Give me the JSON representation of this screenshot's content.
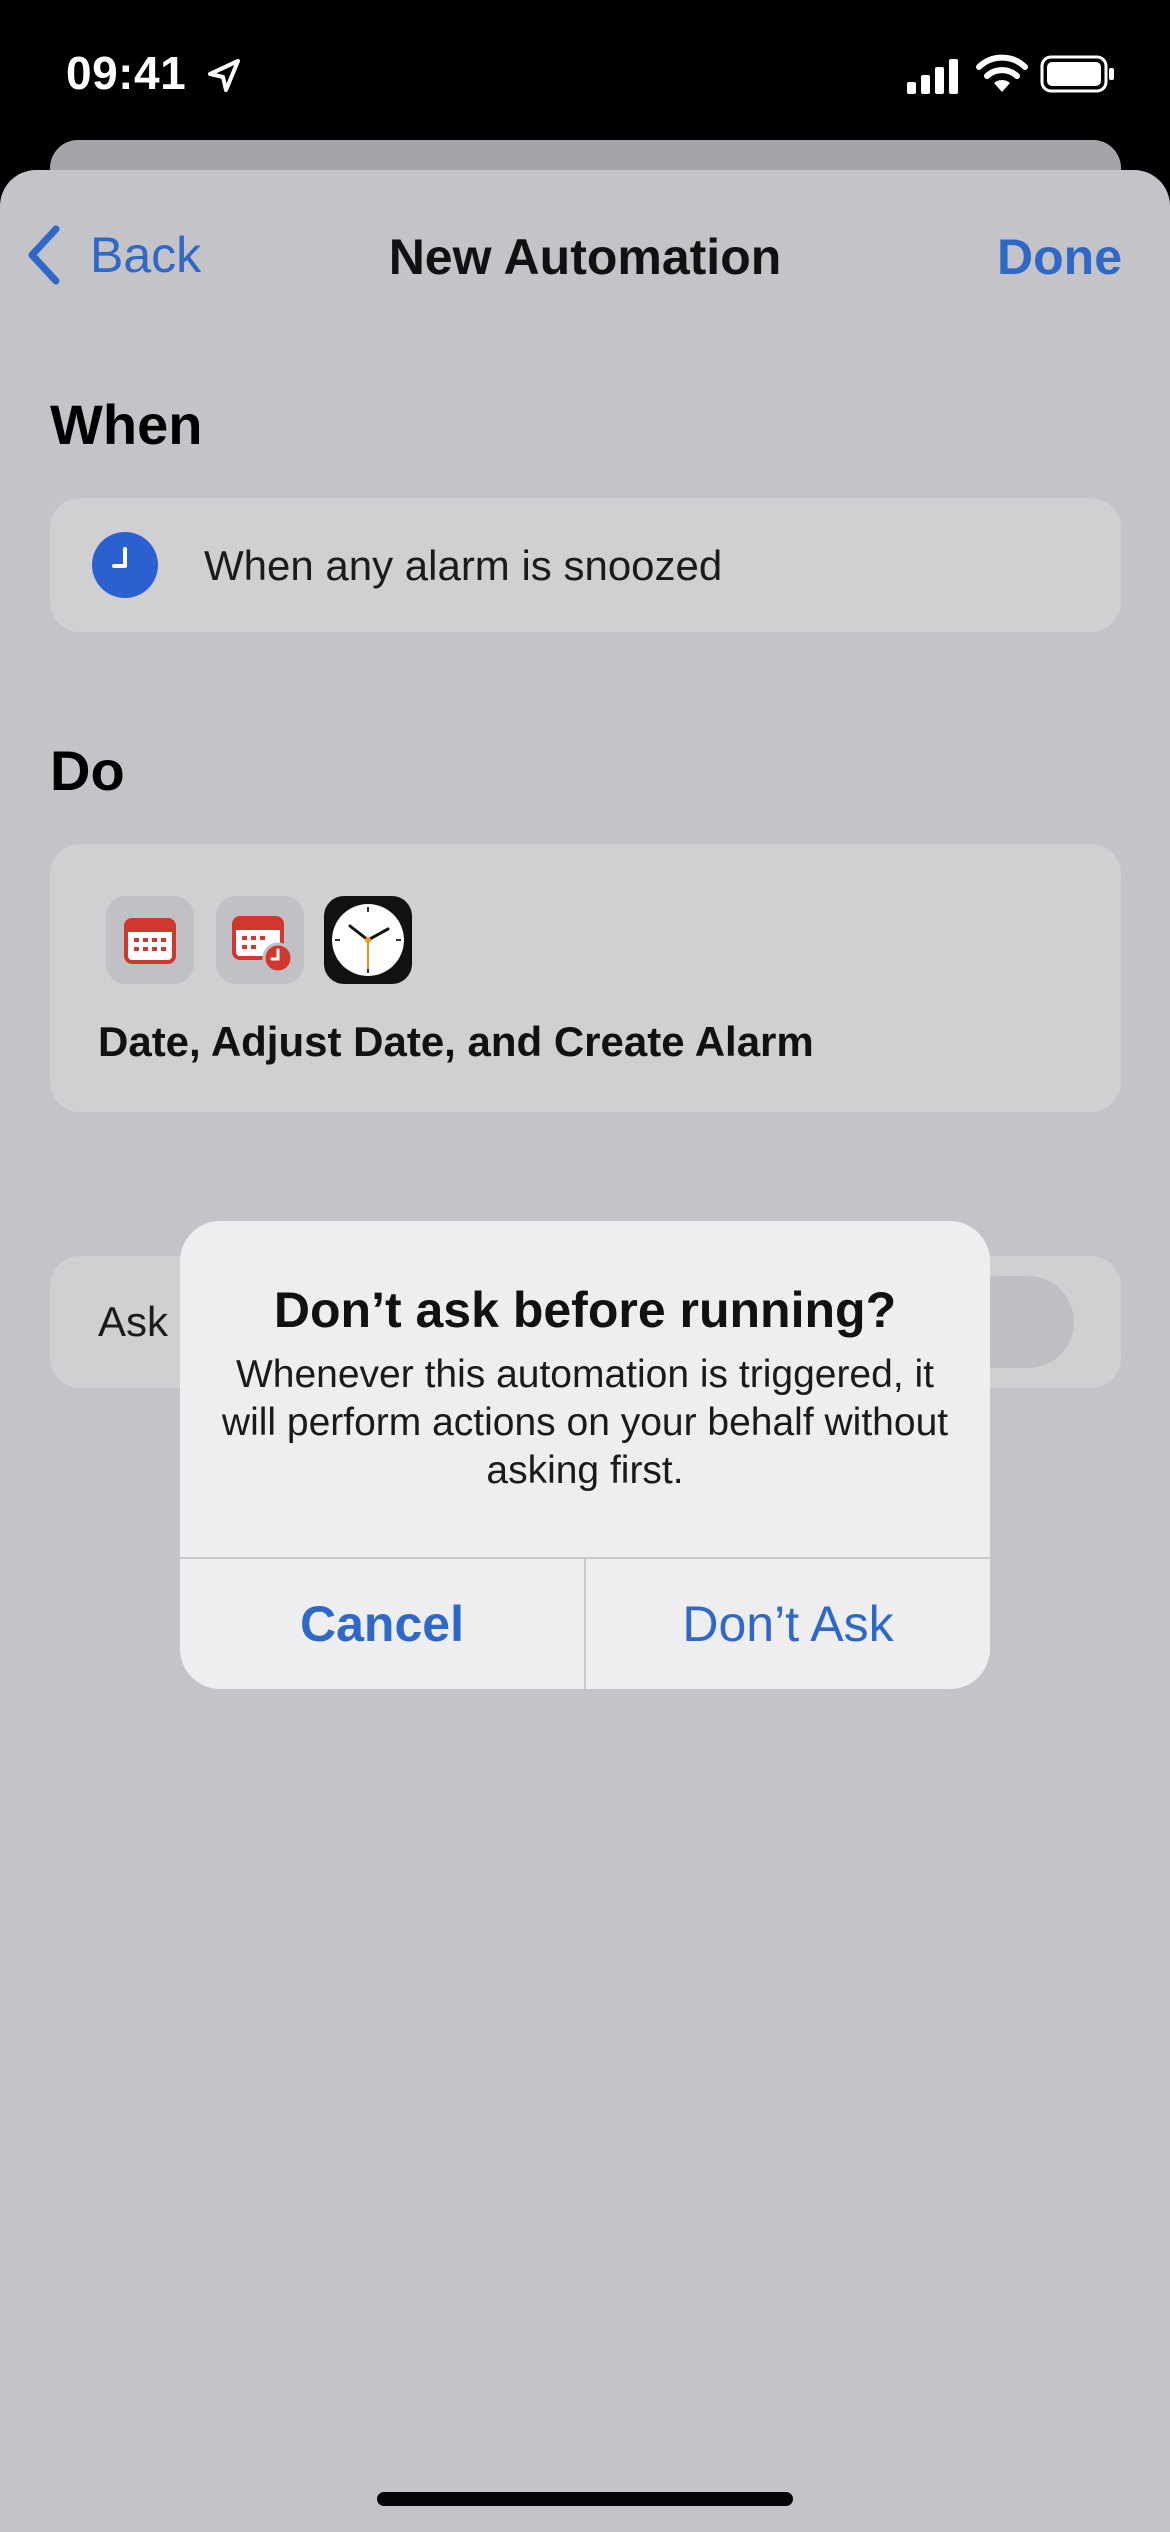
{
  "status_bar": {
    "time": "09:41",
    "icons": [
      "location-arrow-icon",
      "cellular-signal-icon",
      "wifi-icon",
      "battery-icon"
    ]
  },
  "nav": {
    "back_label": "Back",
    "title": "New Automation",
    "done_label": "Done"
  },
  "when": {
    "heading": "When",
    "trigger_text": "When any alarm is snoozed",
    "icon": "clock-icon"
  },
  "do": {
    "heading": "Do",
    "action_icons": [
      "calendar-icon",
      "calendar-clock-icon",
      "clock-app-icon"
    ],
    "summary": "Date, Adjust Date, and Create Alarm"
  },
  "ask": {
    "label": "Ask"
  },
  "alert": {
    "title": "Don’t ask before running?",
    "message": "Whenever this automation is triggered, it will perform actions on your behalf without asking first.",
    "cancel_label": "Cancel",
    "confirm_label": "Don’t Ask"
  },
  "colors": {
    "accent": "#2f68c6",
    "sheet_background": "#c3c3c8",
    "card_background": "#d0d0d3",
    "alert_background": "#eeeef0"
  }
}
